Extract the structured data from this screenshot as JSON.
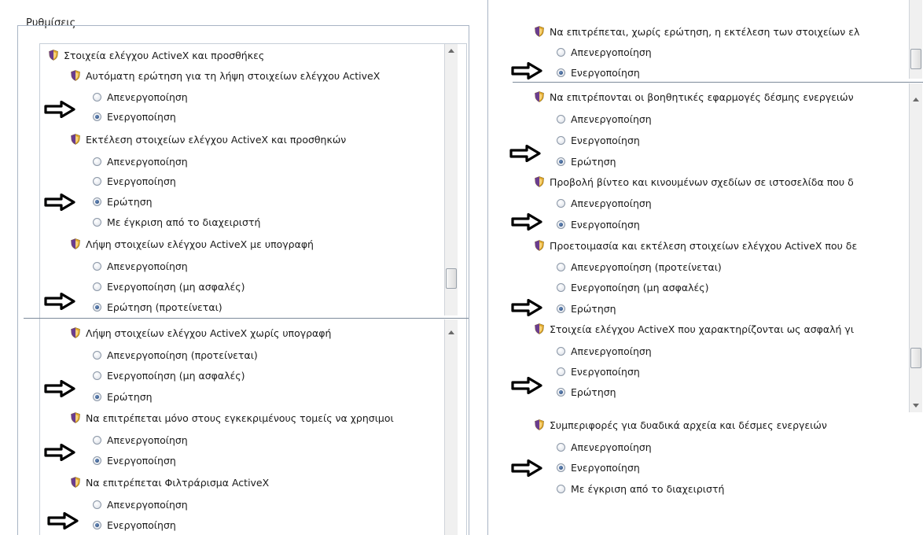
{
  "window": {
    "title": "Ρυθμίσεις"
  },
  "options": {
    "disable": "Απενεργοποίηση",
    "enable": "Ενεργοποίηση",
    "prompt": "Ερώτηση",
    "admin_approved": "Με έγκριση από το διαχειριστή",
    "disable_recommended": "Απενεργοποίηση (προτείνεται)",
    "enable_unsafe": "Ενεργοποίηση (μη ασφαλές)",
    "prompt_recommended": "Ερώτηση (προτείνεται)"
  },
  "left": {
    "category": "Στοιχεία ελέγχου ActiveX και προσθήκες",
    "settings": [
      "Αυτόματη ερώτηση για τη λήψη στοιχείων ελέγχου ActiveX",
      "Εκτέλεση στοιχείων ελέγχου ActiveX και προσθηκών",
      "Λήψη στοιχείων ελέγχου ActiveX με υπογραφή",
      "Λήψη στοιχείων ελέγχου ActiveX χωρίς υπογραφή",
      "Να επιτρέπεται μόνο στους εγκεκριμένους τομείς να χρησιμοι",
      "Να επιτρέπεται Φιλτράρισμα ActiveX"
    ]
  },
  "right": {
    "settings": [
      "Να επιτρέπεται, χωρίς ερώτηση, η εκτέλεση των στοιχείων ελ",
      "Να επιτρέπονται οι βοηθητικές εφαρμογές δέσμης ενεργειών",
      "Προβολή βίντεο και κινουμένων σχεδίων σε ιστοσελίδα που δ",
      "Προετοιμασία και εκτέλεση στοιχείων ελέγχου ActiveX που δε",
      "Στοιχεία ελέγχου ActiveX που χαρακτηρίζονται ως ασφαλή γι",
      "Συμπεριφορές για δυαδικά αρχεία και δέσμες ενεργειών"
    ]
  },
  "colors": {
    "arrow": "#000000",
    "frame": "#a8b4c4",
    "shield_gold": "#e0a72a",
    "shield_purple": "#6a3d8f"
  },
  "icons": {
    "setting": "shield-icon",
    "pointer": "right-arrow-icon"
  }
}
